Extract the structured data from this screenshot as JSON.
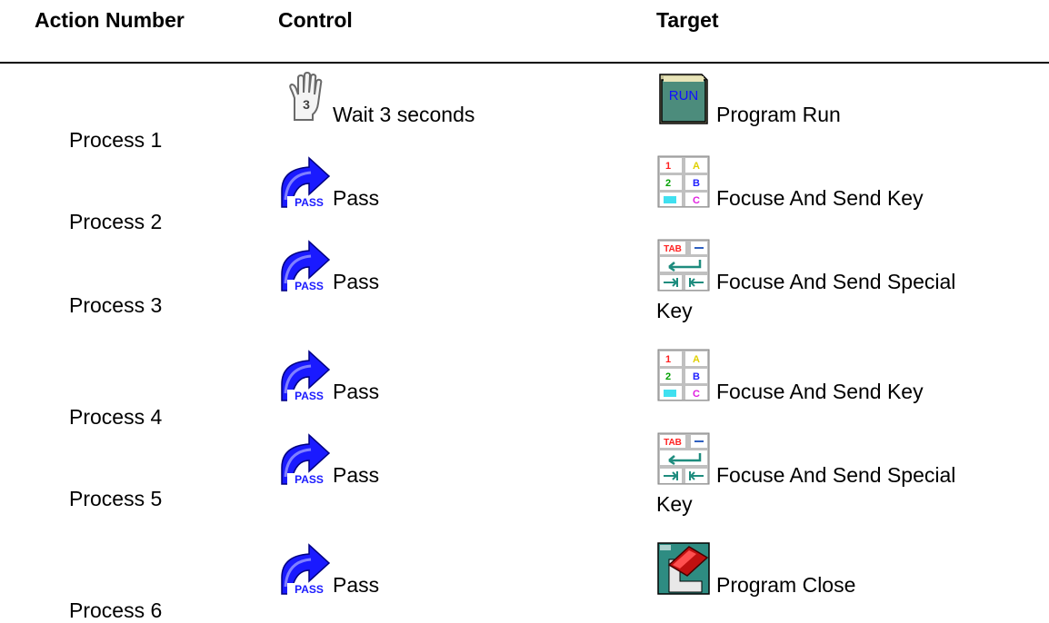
{
  "headers": {
    "action_number": "Action Number",
    "control": "Control",
    "target": "Target"
  },
  "rows": [
    {
      "process": "Process 1",
      "control": {
        "icon": "hand-wait-icon",
        "label": "Wait 3 seconds"
      },
      "target": {
        "icon": "program-run-icon",
        "label": "Program Run",
        "label_line2": ""
      }
    },
    {
      "process": "Process 2",
      "control": {
        "icon": "pass-arrow-icon",
        "label": "Pass"
      },
      "target": {
        "icon": "send-key-icon",
        "label": "Focuse And Send Key",
        "label_line2": ""
      }
    },
    {
      "process": "Process 3",
      "control": {
        "icon": "pass-arrow-icon",
        "label": "Pass"
      },
      "target": {
        "icon": "send-special-key-icon",
        "label": "Focuse And Send Special",
        "label_line2": "Key"
      }
    },
    {
      "process": "Process 4",
      "control": {
        "icon": "pass-arrow-icon",
        "label": "Pass"
      },
      "target": {
        "icon": "send-key-icon",
        "label": "Focuse And Send Key",
        "label_line2": ""
      }
    },
    {
      "process": "Process 5",
      "control": {
        "icon": "pass-arrow-icon",
        "label": "Pass"
      },
      "target": {
        "icon": "send-special-key-icon",
        "label": "Focuse And Send Special",
        "label_line2": "Key"
      }
    },
    {
      "process": "Process 6",
      "control": {
        "icon": "pass-arrow-icon",
        "label": "Pass"
      },
      "target": {
        "icon": "program-close-icon",
        "label": "Program Close",
        "label_line2": ""
      }
    }
  ],
  "icon_texts": {
    "hand_digit": "3",
    "pass_text": "PASS",
    "run_text": "RUN",
    "tab_text": "TAB",
    "key_1": "1",
    "key_a": "A",
    "key_2": "2",
    "key_b": "B",
    "key_c": "C"
  },
  "colors": {
    "pass_arrow_blue": "#1a1aff",
    "run_green": "#4c8c7c",
    "run_text_blue": "#1010ff",
    "close_teal": "#2e8c82"
  }
}
